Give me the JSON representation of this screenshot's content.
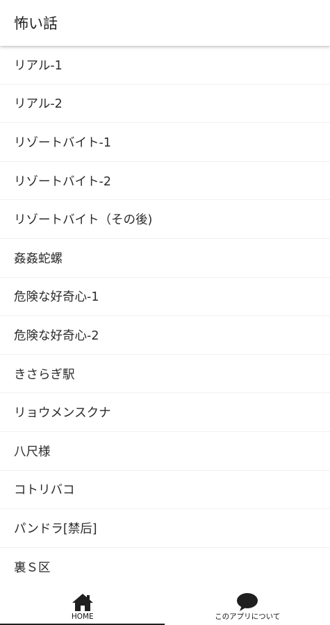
{
  "app_bar": {
    "title": "怖い話"
  },
  "stories": [
    {
      "label": "リアル-1"
    },
    {
      "label": "リアル-2"
    },
    {
      "label": "リゾートバイト-1"
    },
    {
      "label": "リゾートバイト-2"
    },
    {
      "label": "リゾートバイト（その後)"
    },
    {
      "label": "姦姦蛇螺"
    },
    {
      "label": "危険な好奇心-1"
    },
    {
      "label": "危険な好奇心-2"
    },
    {
      "label": "きさらぎ駅"
    },
    {
      "label": "リョウメンスクナ"
    },
    {
      "label": "八尺様"
    },
    {
      "label": "コトリバコ"
    },
    {
      "label": "パンドラ[禁后]"
    },
    {
      "label": "裏Ｓ区"
    }
  ],
  "bottom_nav": {
    "tabs": [
      {
        "label": "HOME",
        "icon": "home-icon",
        "selected": true
      },
      {
        "label": "このアプリについて",
        "icon": "chat-bubble-icon",
        "selected": false
      }
    ]
  },
  "colors": {
    "background": "#ffffff",
    "text": "#2b2b2b",
    "icon": "#1f1f1f",
    "divider": "#f1f1f1"
  }
}
